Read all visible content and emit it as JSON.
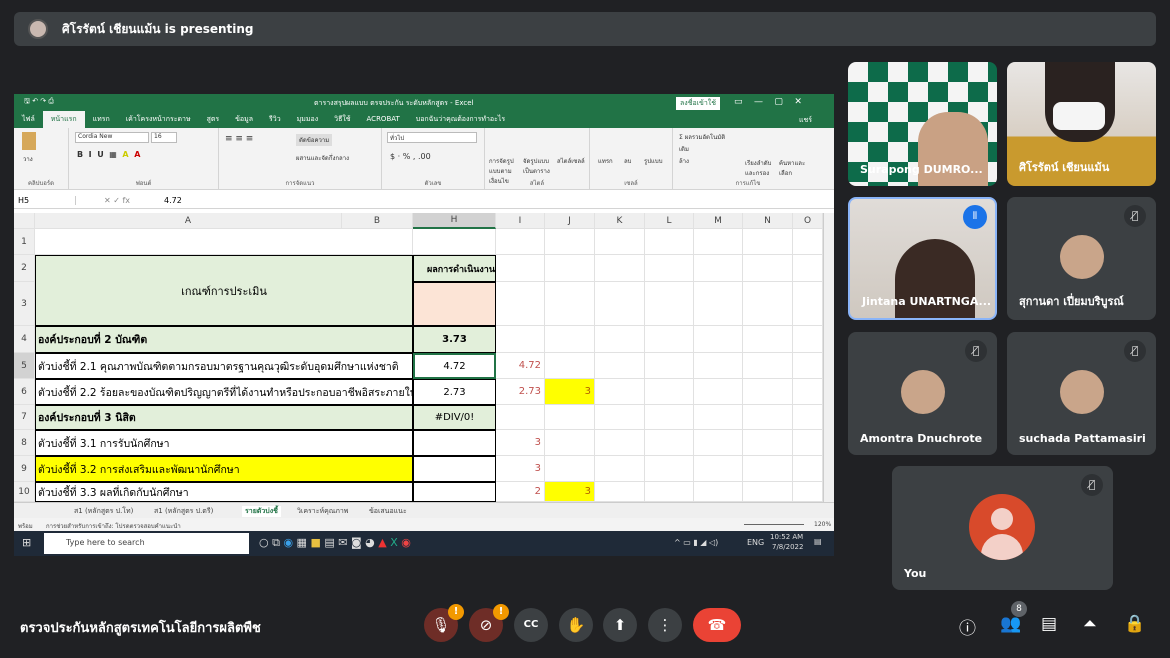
{
  "presenting": {
    "text": "ศิโรรัตน์ เชียนแม้น is presenting"
  },
  "excel": {
    "title": "ตารางสรุปผลแบบ ตรจประกัน ระดับหลักสูตร - Excel",
    "signin": "ลงชื่อเข้าใช้",
    "user": "แชร์",
    "tabs": [
      "ไฟล์",
      "หน้าแรก",
      "แทรก",
      "เค้าโครงหน้ากระดาษ",
      "สูตร",
      "ข้อมูล",
      "รีวิว",
      "มุมมอง",
      "วิธีใช้",
      "ACROBAT",
      "บอกฉันว่าคุณต้องการทำอะไร"
    ],
    "ribbon": {
      "font": "Cordia New",
      "size": "16",
      "number_format": "ทั่วไป",
      "wrap": "ตัดข้อความ",
      "merge": "ผสานและจัดกึ่งกลาง",
      "autosum": "ผลรวมอัตโนมัติ",
      "fill": "เติม",
      "clear": "ล้าง",
      "groups": [
        "คลิปบอร์ด",
        "ฟอนต์",
        "การจัดแนว",
        "ตัวเลข",
        "สไตล์",
        "เซลล์",
        "การแก้ไข"
      ],
      "style_btns": [
        "การจัดรูปแบบตามเงื่อนไข",
        "จัดรูปแบบเป็นตาราง",
        "สไตล์เซลล์"
      ],
      "cell_btns": [
        "แทรก",
        "ลบ",
        "รูปแบบ"
      ],
      "edit_btns": [
        "เรียงลำดับและกรอง",
        "ค้นหาและเลือก"
      ],
      "paste": "วาง"
    },
    "name_box": "H5",
    "formula": "4.72",
    "columns": [
      "A",
      "B",
      "H",
      "I",
      "J",
      "K",
      "L",
      "M",
      "N",
      "O"
    ],
    "rows": [
      {
        "n": "1",
        "A": "",
        "H": "",
        "I": "",
        "J": ""
      },
      {
        "n": "2",
        "A": "เกณฑ์การประเมิน",
        "H": "ผลการดำเนินงาน",
        "I": "",
        "J": ""
      },
      {
        "n": "3",
        "A": "",
        "H": "",
        "I": "",
        "J": ""
      },
      {
        "n": "4",
        "A": "องค์ประกอบที่ 2  บัณฑิต",
        "H": "3.73",
        "I": "",
        "J": ""
      },
      {
        "n": "5",
        "A": "ตัวบ่งชี้ที่  2.1  คุณภาพบัณฑิตตามกรอบมาตรฐานคุณวุฒิระดับอุดมศึกษาแห่งชาติ",
        "H": "4.72",
        "I": "4.72",
        "J": ""
      },
      {
        "n": "6",
        "A": "ตัวบ่งชี้ที่ 2.2 ร้อยละของบัณฑิตปริญญาตรีที่ได้งานทำหรือประกอบอาชีพอิสระภายใน",
        "H": "2.73",
        "I": "2.73",
        "J": "3"
      },
      {
        "n": "7",
        "A": "องค์ประกอบที่ 3  นิสิต",
        "H": "#DIV/0!",
        "I": "",
        "J": ""
      },
      {
        "n": "8",
        "A": "ตัวบ่งชี้ที่  3.1  การรับนักศึกษา",
        "H": "",
        "I": "3",
        "J": ""
      },
      {
        "n": "9",
        "A": "ตัวบ่งชี้ที่  3.2  การส่งเสริมและพัฒนานักศึกษา",
        "H": "",
        "I": "3",
        "J": ""
      },
      {
        "n": "10",
        "A": "ตัวบ่งชี้ที่  3.3  ผลที่เกิดกับนักศึกษา",
        "H": "",
        "I": "2",
        "J": "3"
      }
    ],
    "sheets": [
      "ส1 (หลักสูตร ป.โท)",
      "ส1 (หลักสูตร ป.ตรี)",
      "รายตัวบ่งชี้",
      "วิเคราะห์คุณภาพ",
      "ข้อเสนอแนะ"
    ],
    "active_sheet": "รายตัวบ่งชี้",
    "status_left": "พร้อม",
    "status_msg": "การช่วยสำหรับการเข้าถึง: โปรดตรวจสอบคำแนะนำ",
    "zoom": "120%",
    "search_placeholder": "Type here to search",
    "lang": "ENG",
    "time": "10:52 AM",
    "date": "7/8/2022",
    "colors": {
      "green": "#217346",
      "header_fill": "#e2efda",
      "yellow": "#ffff00",
      "peach": "#fce4d6",
      "red_text": "#c0504d"
    }
  },
  "participants": [
    {
      "name": "Surapong DUMRO...",
      "muted": false
    },
    {
      "name": "ศิโรรัตน์ เชียนแม้น",
      "muted": false
    },
    {
      "name": "Jintana UNARTNGA...",
      "muted": false,
      "speaking": true
    },
    {
      "name": "สุกานดา เปี่ยมบริบูรณ์",
      "muted": true
    },
    {
      "name": "Amontra Dnuchrote",
      "muted": true
    },
    {
      "name": "suchada Pattamasiri",
      "muted": true
    },
    {
      "name": "You",
      "muted": true
    }
  ],
  "meeting": {
    "title": "ตรวจประกันหลักสูตรเทคโนโลยีการผลิตพืช",
    "people_count": "8",
    "end_color": "#ea4335"
  }
}
